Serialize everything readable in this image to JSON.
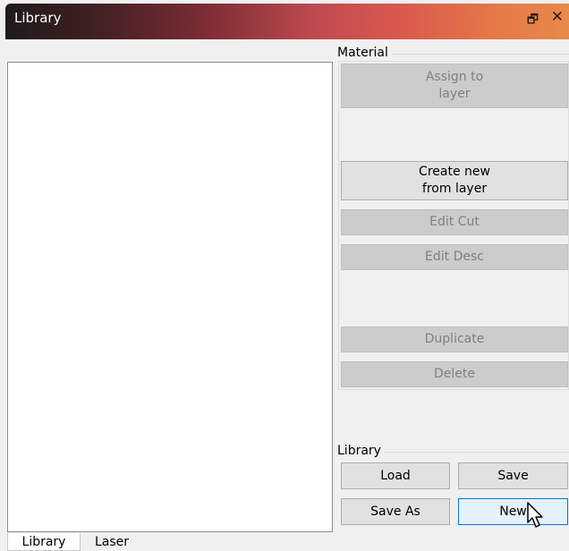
{
  "window": {
    "title": "Library",
    "float_glyph": "🗗",
    "close_glyph": "✕"
  },
  "material_group": {
    "label": "Material",
    "assign_to_layer": "Assign to\nlayer",
    "create_new_from_layer": "Create new\nfrom layer",
    "edit_cut": "Edit Cut",
    "edit_desc": "Edit Desc",
    "duplicate": "Duplicate",
    "delete": "Delete"
  },
  "library_group": {
    "label": "Library",
    "load": "Load",
    "save": "Save",
    "save_as": "Save As",
    "new": "New"
  },
  "tabs": [
    {
      "label": "Library",
      "active": true
    },
    {
      "label": "Laser",
      "active": false
    }
  ]
}
